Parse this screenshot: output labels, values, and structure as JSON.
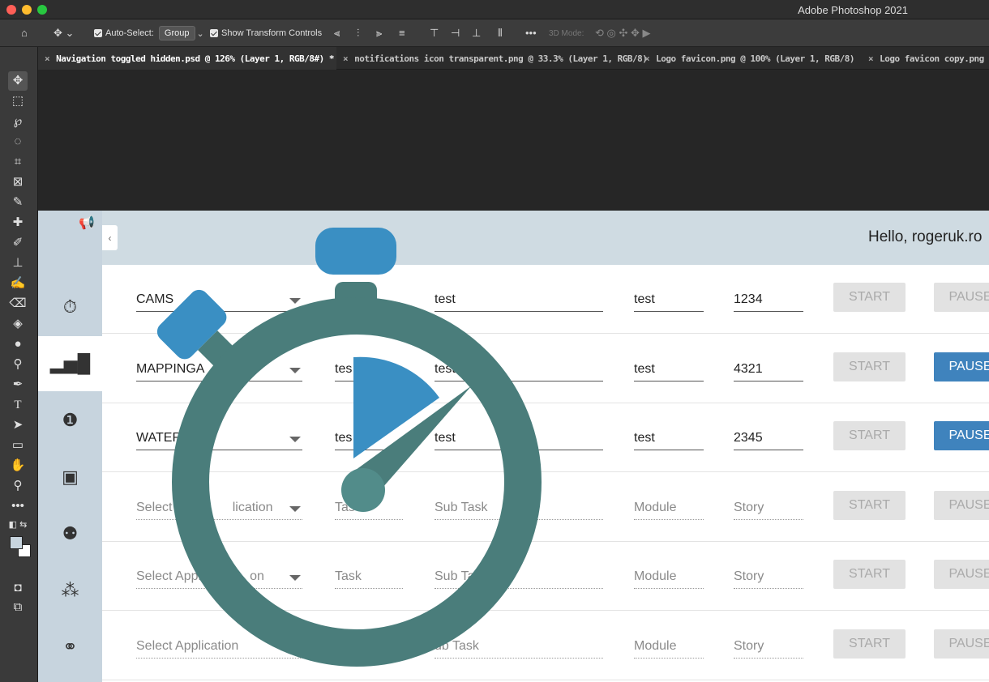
{
  "app_title": "Adobe Photoshop 2021",
  "options_bar": {
    "auto_select_label": "Auto-Select:",
    "auto_select_value": "Group",
    "show_transform_label": "Show Transform Controls",
    "mode_3d_label": "3D Mode:"
  },
  "tabs": [
    {
      "label": "Navigation toggled hidden.psd @ 126% (Layer 1, RGB/8#) *"
    },
    {
      "label": "notifications icon transparent.png @ 33.3% (Layer 1, RGB/8)"
    },
    {
      "label": "Logo favicon.png @ 100% (Layer 1, RGB/8)"
    },
    {
      "label": "Logo favicon copy.png ("
    }
  ],
  "tools": [
    "move-tool",
    "marquee-tool",
    "lasso-tool",
    "quick-select-tool",
    "crop-tool",
    "frame-tool",
    "eyedropper-tool",
    "healing-tool",
    "brush-tool",
    "stamp-tool",
    "history-brush-tool",
    "eraser-tool",
    "paint-bucket-tool",
    "blur-tool",
    "dodge-tool",
    "pen-tool",
    "type-tool",
    "path-select-tool",
    "rectangle-tool",
    "hand-tool",
    "zoom-tool",
    "more-tools",
    "swap-colors-tool",
    "color-swatches",
    "quick-mask-tool",
    "screen-mode-tool"
  ],
  "doc": {
    "greeting": "Hello, rogeruk.ro",
    "collapse_glyph": "‹",
    "rows": [
      {
        "app": "CAMS",
        "task": "",
        "subtask": "test",
        "module": "test",
        "story": "1234",
        "start": "START",
        "pause": "PAUSE",
        "pause_active": false,
        "filled": true
      },
      {
        "app": "MAPPINGA",
        "task": "tes",
        "subtask": "test",
        "module": "test",
        "story": "4321",
        "start": "START",
        "pause": "PAUSE",
        "pause_active": true,
        "filled": true
      },
      {
        "app": "WATER",
        "task": "tes",
        "subtask": "test",
        "module": "test",
        "story": "2345",
        "start": "START",
        "pause": "PAUSE",
        "pause_active": true,
        "filled": true
      },
      {
        "app": "Select A",
        "app2": "lication",
        "task": "Tas",
        "subtask": "Sub Task",
        "module": "Module",
        "story": "Story",
        "start": "START",
        "pause": "PAUSE",
        "pause_active": false,
        "filled": false
      },
      {
        "app": "Select Appl",
        "app2": "on",
        "task": "Task",
        "subtask": "Sub Tas",
        "module": "Module",
        "story": "Story",
        "start": "START",
        "pause": "PAUSE",
        "pause_active": false,
        "filled": false
      },
      {
        "app": "Select Application",
        "task": "",
        "subtask": "ub Task",
        "module": "Module",
        "story": "Story",
        "start": "START",
        "pause": "PAUSE",
        "pause_active": false,
        "filled": false
      }
    ]
  },
  "colors": {
    "stopwatch_ring": "#4a7d7b",
    "stopwatch_blue": "#3a8fc3",
    "pause_blue": "#3f83bd"
  }
}
